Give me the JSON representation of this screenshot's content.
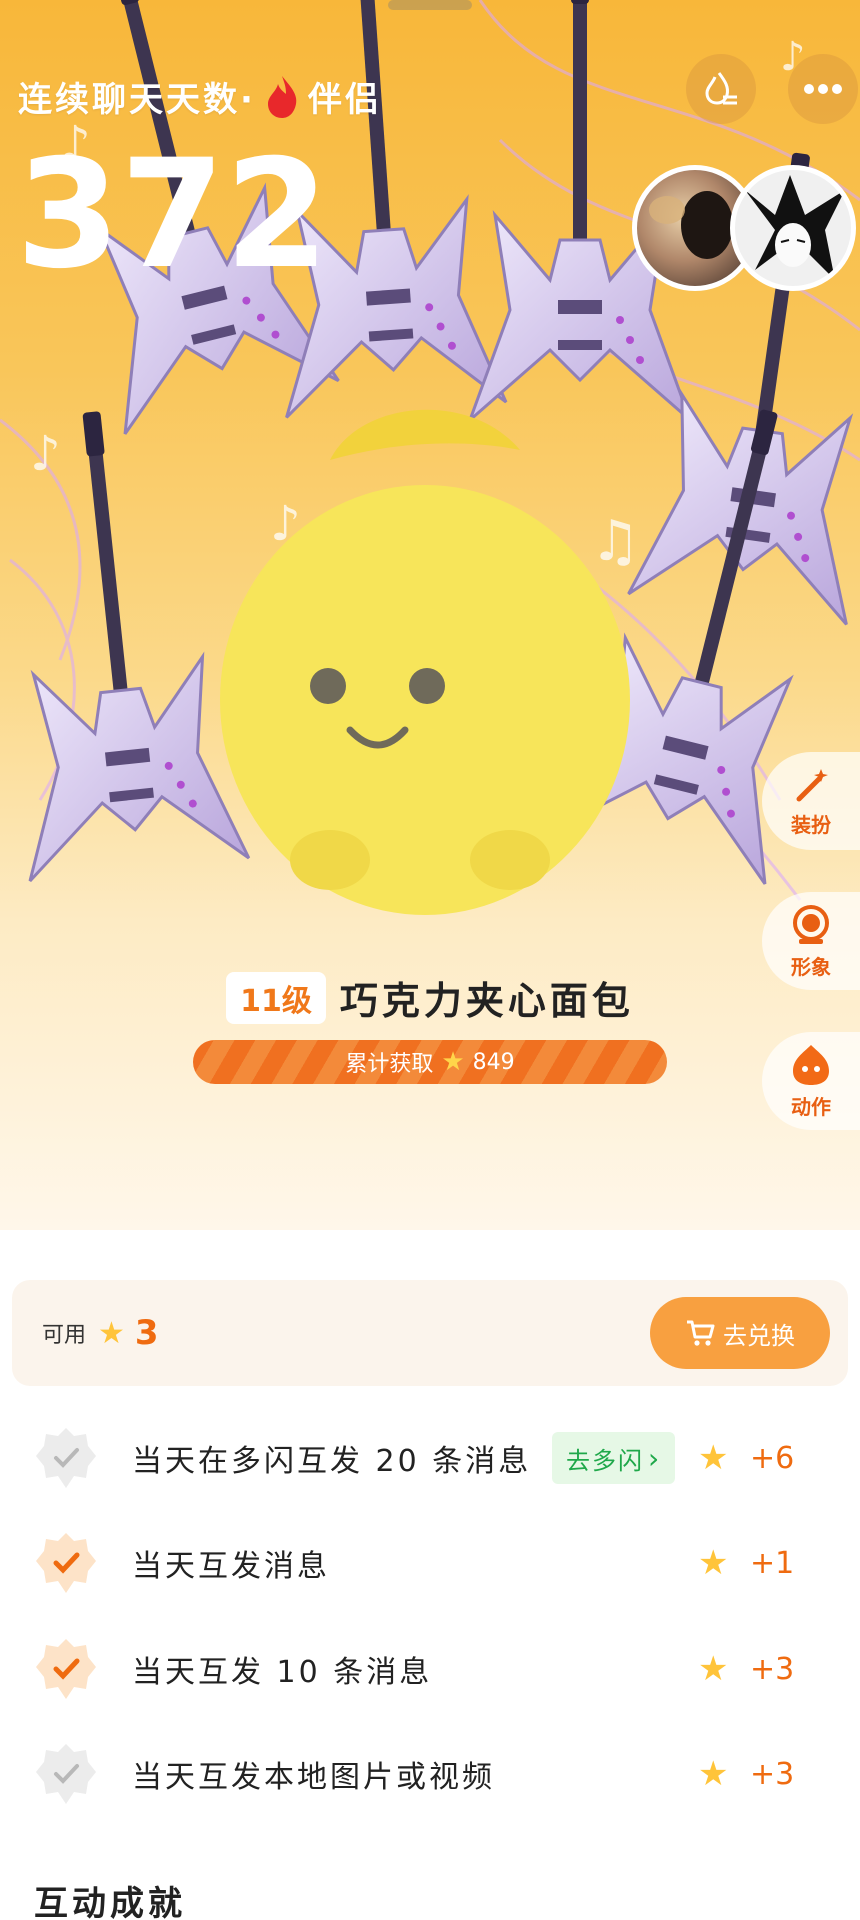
{
  "header": {
    "streak_label": "连续聊天天数·",
    "relation": "伴侣",
    "streak_days": "372",
    "flame_icon": "flame-icon",
    "fire_settings_icon": "fire-filter-icon",
    "more_icon": "more-dots-icon"
  },
  "pet": {
    "level": "11级",
    "name": "巧克力夹心面包",
    "total_label": "累计获取",
    "total_value": "849"
  },
  "side_menu": [
    {
      "label": "装扮",
      "icon": "magic-wand-icon"
    },
    {
      "label": "形象",
      "icon": "appearance-icon"
    },
    {
      "label": "动作",
      "icon": "action-icon"
    }
  ],
  "available": {
    "label": "可用",
    "count": "3",
    "exchange_label": "去兑换",
    "cart_icon": "cart-icon"
  },
  "tasks": [
    {
      "text": "当天在多闪互发 20 条消息",
      "done": false,
      "go_label": "去多闪",
      "reward": "+6"
    },
    {
      "text": "当天互发消息",
      "done": true,
      "go_label": "",
      "reward": "+1"
    },
    {
      "text": "当天互发 10 条消息",
      "done": true,
      "go_label": "",
      "reward": "+3"
    },
    {
      "text": "当天互发本地图片或视频",
      "done": false,
      "go_label": "",
      "reward": "+3"
    }
  ],
  "achievements_title": "互动成就",
  "colors": {
    "accent_orange": "#ef6b10",
    "hero_top": "#f8b73a",
    "go_green": "#1fa84a",
    "star_yellow": "#ffc43a"
  }
}
